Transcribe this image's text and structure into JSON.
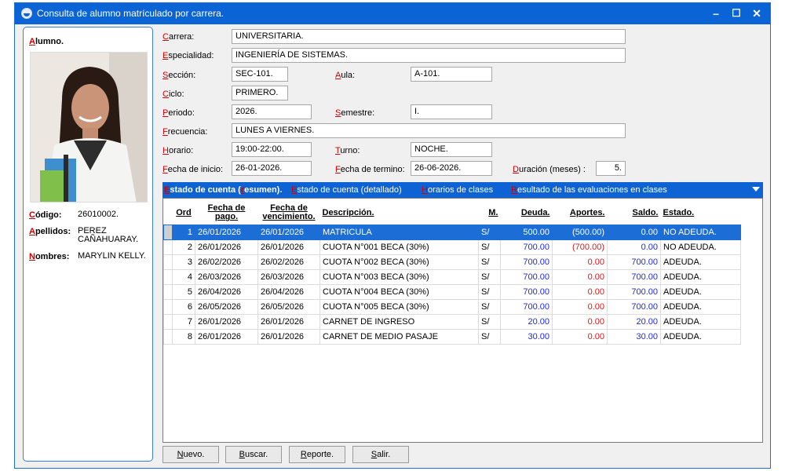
{
  "window": {
    "title": "Consulta de alumno matrículado por carrera."
  },
  "left": {
    "title_first": "A",
    "title_rest": "lumno.",
    "codigo_label_first": "C",
    "codigo_label_rest": "ódigo:",
    "codigo_value": "26010002.",
    "apellidos_label_first": "A",
    "apellidos_label_rest": "pellidos:",
    "apellidos_value": "PEREZ CAÑAHUARAY.",
    "nombres_label_first": "N",
    "nombres_label_rest": "ombres:",
    "nombres_value": "MARYLIN KELLY."
  },
  "form": {
    "carrera": {
      "first": "C",
      "rest": "arrera:",
      "value": "UNIVERSITARIA."
    },
    "especialidad": {
      "first": "E",
      "rest": "specialidad:",
      "value": "INGENIERÍA DE SISTEMAS."
    },
    "seccion": {
      "first": "S",
      "rest": "ección:",
      "value": "SEC-101."
    },
    "aula": {
      "first": "A",
      "rest": "ula:",
      "value": "A-101."
    },
    "ciclo": {
      "first": "C",
      "rest": "iclo:",
      "value": "PRIMERO."
    },
    "periodo": {
      "first": "P",
      "rest": "eriodo:",
      "value": "2026."
    },
    "semestre": {
      "first": "S",
      "rest": "emestre:",
      "value": "I."
    },
    "frecuencia": {
      "first": "F",
      "rest": "recuencia:",
      "value": "LUNES A VIERNES."
    },
    "horario": {
      "first": "H",
      "rest": "orario:",
      "value": "19:00-22:00."
    },
    "turno": {
      "first": "T",
      "rest": "urno:",
      "value": "NOCHE."
    },
    "fecha_inicio": {
      "first": "F",
      "rest": "echa de inicio:",
      "value": "26-01-2026."
    },
    "fecha_termino": {
      "first": "F",
      "rest": "echa de termino:",
      "value": "26-06-2026."
    },
    "duracion": {
      "first": "D",
      "rest": "uración (meses) :",
      "value": "5."
    }
  },
  "tabs": [
    {
      "first": "E",
      "rest": "stado de cuenta (",
      "mid_first": "r",
      "mid_rest": "esumen)."
    },
    {
      "first": "E",
      "rest": "stado de cuenta (detallado)"
    },
    {
      "first": "H",
      "rest": "orarios de clases"
    },
    {
      "first": "R",
      "rest": "esultado de las evaluaciones en clases"
    }
  ],
  "grid": {
    "headers": [
      "Ord",
      "Fecha de pago.",
      "Fecha de vencimiento.",
      "Descripción.",
      "M.",
      "Deuda.",
      "Aportes.",
      "Saldo.",
      "Estado."
    ],
    "rows": [
      {
        "ord": "1",
        "pago": "26/01/2026",
        "venc": "26/01/2026",
        "desc": "MATRICULA",
        "m": "S/",
        "deuda": "500.00",
        "aportes": "(500.00)",
        "saldo": "0.00",
        "estado": "NO ADEUDA."
      },
      {
        "ord": "2",
        "pago": "26/01/2026",
        "venc": "26/01/2026",
        "desc": "CUOTA N°001  BECA (30%)",
        "m": "S/",
        "deuda": "700.00",
        "aportes": "(700.00)",
        "saldo": "0.00",
        "estado": "NO ADEUDA."
      },
      {
        "ord": "3",
        "pago": "26/02/2026",
        "venc": "26/02/2026",
        "desc": "CUOTA N°002  BECA (30%)",
        "m": "S/",
        "deuda": "700.00",
        "aportes": "0.00",
        "saldo": "700.00",
        "estado": "ADEUDA."
      },
      {
        "ord": "4",
        "pago": "26/03/2026",
        "venc": "26/03/2026",
        "desc": "CUOTA N°003  BECA (30%)",
        "m": "S/",
        "deuda": "700.00",
        "aportes": "0.00",
        "saldo": "700.00",
        "estado": "ADEUDA."
      },
      {
        "ord": "5",
        "pago": "26/04/2026",
        "venc": "26/04/2026",
        "desc": "CUOTA N°004  BECA (30%)",
        "m": "S/",
        "deuda": "700.00",
        "aportes": "0.00",
        "saldo": "700.00",
        "estado": "ADEUDA."
      },
      {
        "ord": "6",
        "pago": "26/05/2026",
        "venc": "26/05/2026",
        "desc": "CUOTA N°005  BECA (30%)",
        "m": "S/",
        "deuda": "700.00",
        "aportes": "0.00",
        "saldo": "700.00",
        "estado": "ADEUDA."
      },
      {
        "ord": "7",
        "pago": "26/01/2026",
        "venc": "26/01/2026",
        "desc": "CARNET DE INGRESO",
        "m": "S/",
        "deuda": "20.00",
        "aportes": "0.00",
        "saldo": "20.00",
        "estado": "ADEUDA."
      },
      {
        "ord": "8",
        "pago": "26/01/2026",
        "venc": "26/01/2026",
        "desc": "CARNET DE MEDIO PASAJE",
        "m": "S/",
        "deuda": "30.00",
        "aportes": "0.00",
        "saldo": "30.00",
        "estado": "ADEUDA."
      }
    ]
  },
  "buttons": {
    "nuevo": {
      "first": "N",
      "rest": "uevo."
    },
    "buscar": {
      "first": "B",
      "rest": "uscar."
    },
    "reporte": {
      "first": "R",
      "rest": "eporte."
    },
    "salir": {
      "first": "S",
      "rest": "alir."
    }
  },
  "colors": {
    "titlebar": "#0a64d6",
    "tabstrip": "#0d63d4",
    "selection": "#1c6dd6",
    "accent_red": "#d00000",
    "value_blue": "#1f2bd6"
  }
}
